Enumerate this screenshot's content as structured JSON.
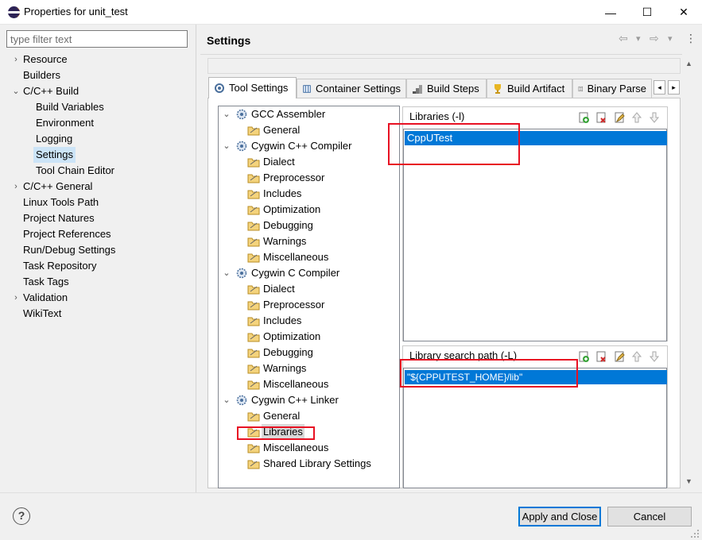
{
  "window": {
    "title": "Properties for unit_test",
    "minimize": "—",
    "maximize": "☐",
    "close": "✕"
  },
  "filter": {
    "placeholder": "type filter text"
  },
  "left_tree": [
    {
      "label": "Resource",
      "level": 0,
      "expander": "›"
    },
    {
      "label": "Builders",
      "level": 0,
      "expander": ""
    },
    {
      "label": "C/C++ Build",
      "level": 0,
      "expander": "⌄"
    },
    {
      "label": "Build Variables",
      "level": 1,
      "expander": ""
    },
    {
      "label": "Environment",
      "level": 1,
      "expander": ""
    },
    {
      "label": "Logging",
      "level": 1,
      "expander": ""
    },
    {
      "label": "Settings",
      "level": 1,
      "expander": "",
      "selected": true
    },
    {
      "label": "Tool Chain Editor",
      "level": 1,
      "expander": ""
    },
    {
      "label": "C/C++ General",
      "level": 0,
      "expander": "›"
    },
    {
      "label": "Linux Tools Path",
      "level": 0,
      "expander": ""
    },
    {
      "label": "Project Natures",
      "level": 0,
      "expander": ""
    },
    {
      "label": "Project References",
      "level": 0,
      "expander": ""
    },
    {
      "label": "Run/Debug Settings",
      "level": 0,
      "expander": ""
    },
    {
      "label": "Task Repository",
      "level": 0,
      "expander": ""
    },
    {
      "label": "Task Tags",
      "level": 0,
      "expander": ""
    },
    {
      "label": "Validation",
      "level": 0,
      "expander": "›"
    },
    {
      "label": "WikiText",
      "level": 0,
      "expander": ""
    }
  ],
  "header": {
    "title": "Settings",
    "back_icon": "⇦",
    "forward_icon": "⇨",
    "dropdown_icon": "▾",
    "menu_icon": "⋮"
  },
  "tabs": [
    {
      "label": "Tool Settings",
      "active": true,
      "icon": "tool-settings-icon"
    },
    {
      "label": "Container Settings",
      "active": false,
      "icon": "container-icon"
    },
    {
      "label": "Build Steps",
      "active": false,
      "icon": "build-steps-icon"
    },
    {
      "label": "Build Artifact",
      "active": false,
      "icon": "trophy-icon"
    },
    {
      "label": "Binary Parse",
      "active": false,
      "icon": "binary-icon"
    }
  ],
  "tab_scroll": {
    "left": "◂",
    "right": "▸"
  },
  "tool_tree": [
    {
      "label": "GCC Assembler",
      "kind": "tool"
    },
    {
      "label": "General",
      "kind": "option"
    },
    {
      "label": "Cygwin C++ Compiler",
      "kind": "tool"
    },
    {
      "label": "Dialect",
      "kind": "option"
    },
    {
      "label": "Preprocessor",
      "kind": "option"
    },
    {
      "label": "Includes",
      "kind": "option"
    },
    {
      "label": "Optimization",
      "kind": "option"
    },
    {
      "label": "Debugging",
      "kind": "option"
    },
    {
      "label": "Warnings",
      "kind": "option"
    },
    {
      "label": "Miscellaneous",
      "kind": "option"
    },
    {
      "label": "Cygwin C Compiler",
      "kind": "tool"
    },
    {
      "label": "Dialect",
      "kind": "option"
    },
    {
      "label": "Preprocessor",
      "kind": "option"
    },
    {
      "label": "Includes",
      "kind": "option"
    },
    {
      "label": "Optimization",
      "kind": "option"
    },
    {
      "label": "Debugging",
      "kind": "option"
    },
    {
      "label": "Warnings",
      "kind": "option"
    },
    {
      "label": "Miscellaneous",
      "kind": "option"
    },
    {
      "label": "Cygwin C++ Linker",
      "kind": "tool"
    },
    {
      "label": "General",
      "kind": "option"
    },
    {
      "label": "Libraries",
      "kind": "option",
      "selected": true
    },
    {
      "label": "Miscellaneous",
      "kind": "option"
    },
    {
      "label": "Shared Library Settings",
      "kind": "option"
    }
  ],
  "libraries": {
    "header": "Libraries (-l)",
    "items": [
      "CppUTest"
    ]
  },
  "library_paths": {
    "header": "Library search path (-L)",
    "items": [
      "\"${CPPUTEST_HOME}/lib\""
    ]
  },
  "buttons": {
    "help": "?",
    "apply_close": "Apply and Close",
    "cancel": "Cancel"
  },
  "colors": {
    "selection": "#0078d7",
    "highlight_box": "#e81123",
    "tree_selection": "#cce4f7"
  }
}
